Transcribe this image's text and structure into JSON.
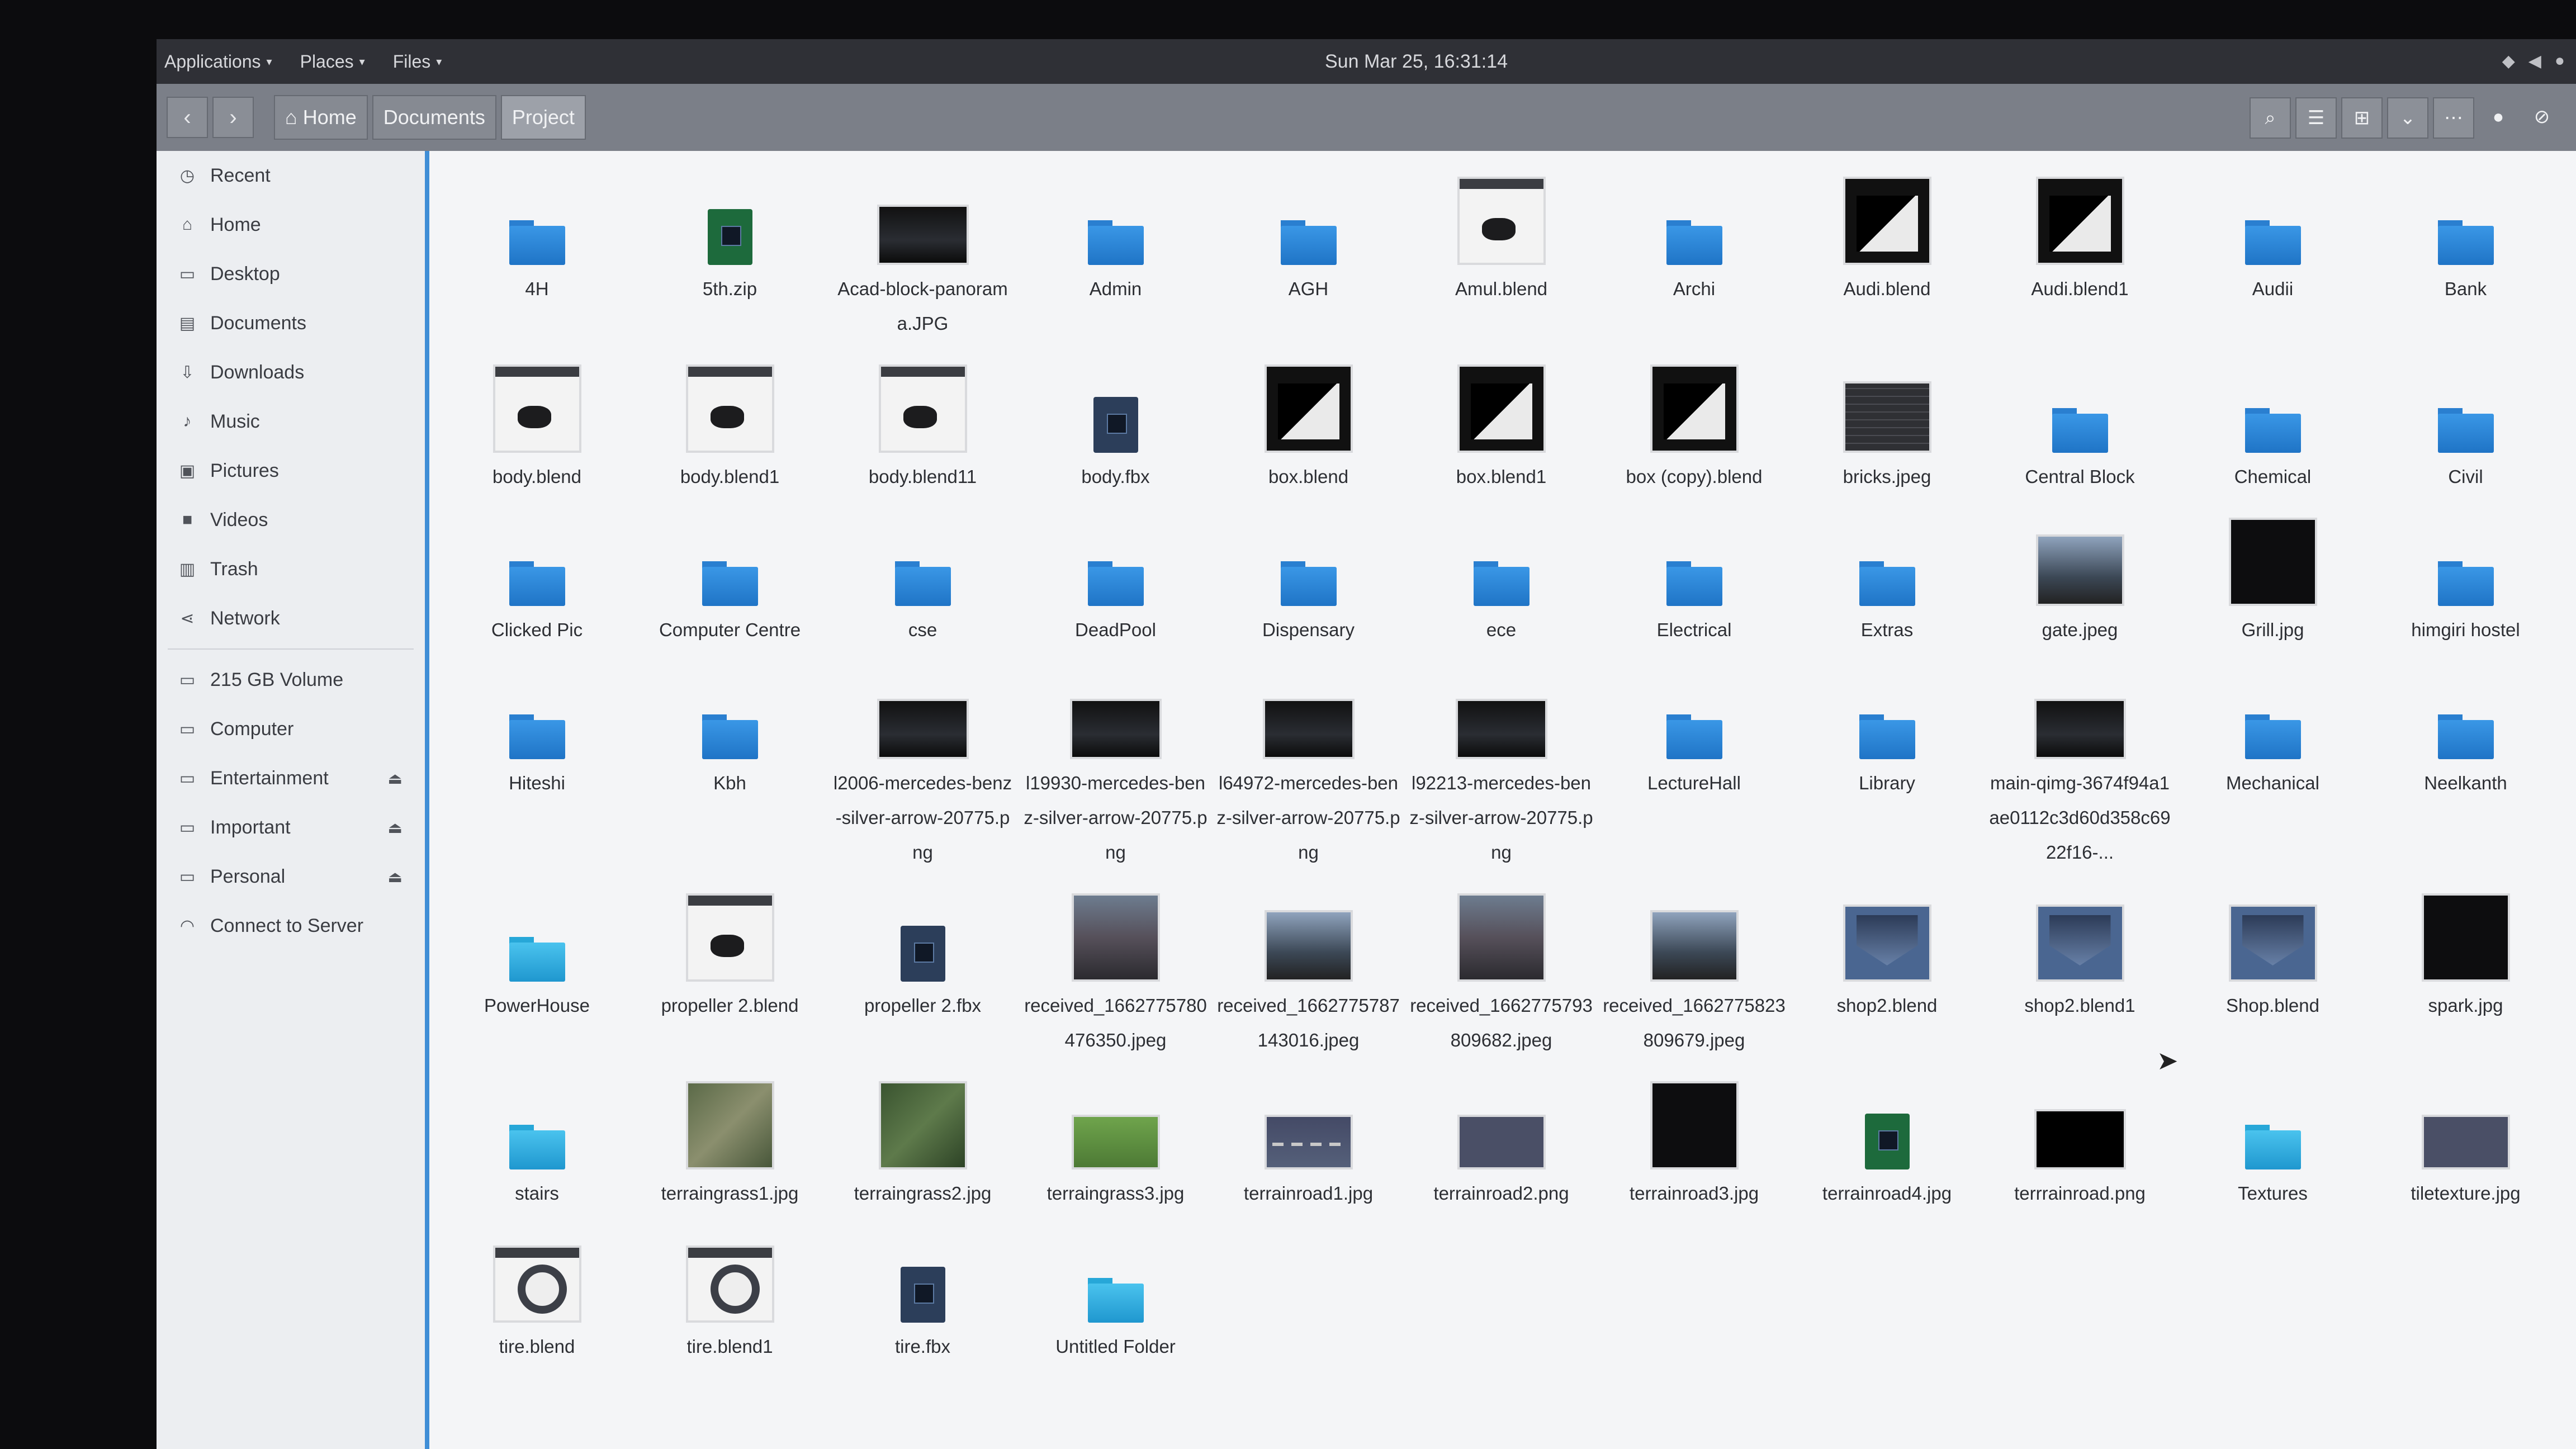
{
  "top_panel": {
    "menus": [
      "Applications",
      "Places",
      "Files"
    ],
    "clock": "Sun Mar 25, 16:31:14"
  },
  "toolbar": {
    "back_icon": "chevron-left-icon",
    "forward_icon": "chevron-right-icon",
    "breadcrumbs": [
      "Home",
      "Documents",
      "Project"
    ],
    "active_crumb": "Project"
  },
  "sidebar": {
    "places": [
      {
        "label": "Recent",
        "icon": "clock-icon"
      },
      {
        "label": "Home",
        "icon": "home-icon"
      },
      {
        "label": "Desktop",
        "icon": "desktop-icon"
      },
      {
        "label": "Documents",
        "icon": "documents-icon"
      },
      {
        "label": "Downloads",
        "icon": "downloads-icon"
      },
      {
        "label": "Music",
        "icon": "music-icon"
      },
      {
        "label": "Pictures",
        "icon": "pictures-icon"
      },
      {
        "label": "Videos",
        "icon": "videos-icon"
      },
      {
        "label": "Trash",
        "icon": "trash-icon"
      },
      {
        "label": "Network",
        "icon": "network-icon"
      }
    ],
    "devices": [
      {
        "label": "215 GB Volume",
        "eject": false
      },
      {
        "label": "Computer",
        "eject": false
      },
      {
        "label": "Entertainment",
        "eject": true
      },
      {
        "label": "Important",
        "eject": true
      },
      {
        "label": "Personal",
        "eject": true
      },
      {
        "label": "Connect to Server",
        "eject": false
      }
    ]
  },
  "files": [
    {
      "name": "4H",
      "type": "folder"
    },
    {
      "name": "5th.zip",
      "type": "zip"
    },
    {
      "name": "Acad-block-panorama.JPG",
      "type": "image-wide"
    },
    {
      "name": "Admin",
      "type": "folder"
    },
    {
      "name": "AGH",
      "type": "folder"
    },
    {
      "name": "Amul.blend",
      "type": "blend"
    },
    {
      "name": "Archi",
      "type": "folder"
    },
    {
      "name": "Audi.blend",
      "type": "blend-dark"
    },
    {
      "name": "Audi.blend1",
      "type": "blend-dark"
    },
    {
      "name": "Audii",
      "type": "folder"
    },
    {
      "name": "Bank",
      "type": "folder"
    },
    {
      "name": "body.blend",
      "type": "blend"
    },
    {
      "name": "body.blend1",
      "type": "blend"
    },
    {
      "name": "body.blend11",
      "type": "blend"
    },
    {
      "name": "body.fbx",
      "type": "fbx"
    },
    {
      "name": "box.blend",
      "type": "blend-dark"
    },
    {
      "name": "box.blend1",
      "type": "blend-dark"
    },
    {
      "name": "box (copy).blend",
      "type": "blend-dark"
    },
    {
      "name": "bricks.jpeg",
      "type": "bricks"
    },
    {
      "name": "Central Block",
      "type": "folder"
    },
    {
      "name": "Chemical",
      "type": "folder"
    },
    {
      "name": "Civil",
      "type": "folder"
    },
    {
      "name": "Clicked Pic",
      "type": "folder"
    },
    {
      "name": "Computer Centre",
      "type": "folder"
    },
    {
      "name": "cse",
      "type": "folder"
    },
    {
      "name": "DeadPool",
      "type": "folder"
    },
    {
      "name": "Dispensary",
      "type": "folder"
    },
    {
      "name": "ece",
      "type": "folder"
    },
    {
      "name": "Electrical",
      "type": "folder"
    },
    {
      "name": "Extras",
      "type": "folder"
    },
    {
      "name": "gate.jpeg",
      "type": "photo"
    },
    {
      "name": "Grill.jpg",
      "type": "black"
    },
    {
      "name": "himgiri hostel",
      "type": "folder"
    },
    {
      "name": "Hiteshi",
      "type": "folder"
    },
    {
      "name": "Kbh",
      "type": "folder"
    },
    {
      "name": "l2006-mercedes-benz-silver-arrow-20775.png",
      "type": "image-wide"
    },
    {
      "name": "l19930-mercedes-benz-silver-arrow-20775.png",
      "type": "image-wide"
    },
    {
      "name": "l64972-mercedes-benz-silver-arrow-20775.png",
      "type": "image-wide"
    },
    {
      "name": "l92213-mercedes-benz-silver-arrow-20775.png",
      "type": "image-wide"
    },
    {
      "name": "LectureHall",
      "type": "folder"
    },
    {
      "name": "Library",
      "type": "folder"
    },
    {
      "name": "main-qimg-3674f94a1ae0112c3d60d358c6922f16-...",
      "type": "image-wide"
    },
    {
      "name": "Mechanical",
      "type": "folder"
    },
    {
      "name": "Neelkanth",
      "type": "folder"
    },
    {
      "name": "PowerHouse",
      "type": "folder-cyan"
    },
    {
      "name": "propeller 2.blend",
      "type": "blend"
    },
    {
      "name": "propeller 2.fbx",
      "type": "fbx"
    },
    {
      "name": "received_1662775780476350.jpeg",
      "type": "photo2"
    },
    {
      "name": "received_1662775787143016.jpeg",
      "type": "photo"
    },
    {
      "name": "received_1662775793809682.jpeg",
      "type": "photo2"
    },
    {
      "name": "received_1662775823809679.jpeg",
      "type": "photo"
    },
    {
      "name": "shop2.blend",
      "type": "shop"
    },
    {
      "name": "shop2.blend1",
      "type": "shop"
    },
    {
      "name": "Shop.blend",
      "type": "shop"
    },
    {
      "name": "spark.jpg",
      "type": "black"
    },
    {
      "name": "stairs",
      "type": "folder-cyan"
    },
    {
      "name": "terraingrass1.jpg",
      "type": "grass"
    },
    {
      "name": "terraingrass2.jpg",
      "type": "grass2"
    },
    {
      "name": "terraingrass3.jpg",
      "type": "grass3"
    },
    {
      "name": "terrainroad1.jpg",
      "type": "road"
    },
    {
      "name": "terrainroad2.png",
      "type": "gray"
    },
    {
      "name": "terrainroad3.jpg",
      "type": "black"
    },
    {
      "name": "terrainroad4.jpg",
      "type": "zip"
    },
    {
      "name": "terrrainroad.png",
      "type": "black-wide"
    },
    {
      "name": "Textures",
      "type": "folder-cyan"
    },
    {
      "name": "tiletexture.jpg",
      "type": "gray"
    },
    {
      "name": "tire.blend",
      "type": "tire"
    },
    {
      "name": "tire.blend1",
      "type": "tire"
    },
    {
      "name": "tire.fbx",
      "type": "fbx"
    },
    {
      "name": "Untitled Folder",
      "type": "folder-cyan"
    }
  ]
}
